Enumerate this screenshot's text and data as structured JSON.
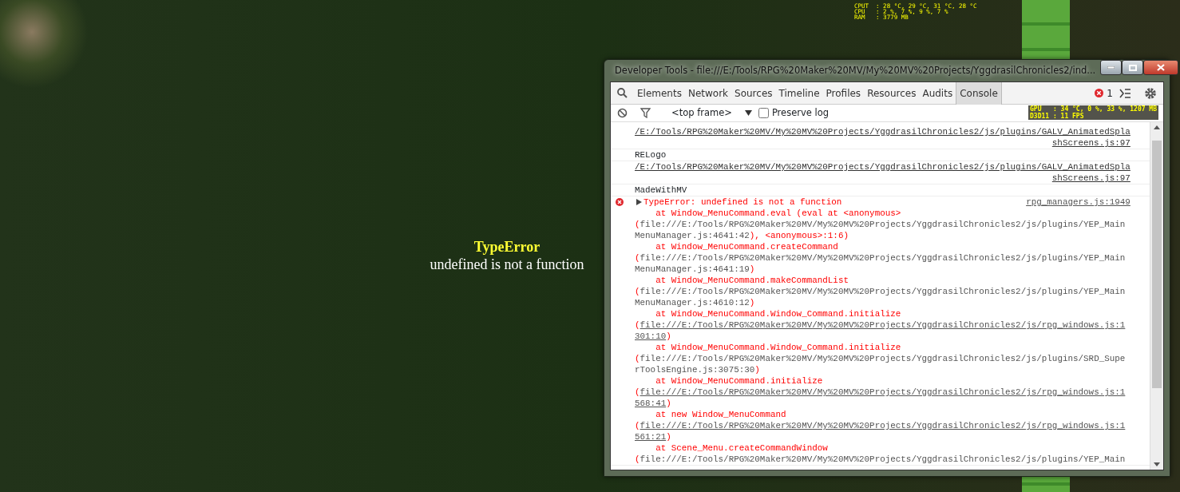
{
  "game": {
    "error_title": "TypeError",
    "error_message": "undefined is not a function",
    "stats": [
      "CPUT  : 28 °C, 29 °C, 31 °C, 28 °C",
      "CPU   : 2 %, 7 %, 9 %, 7 %",
      "RAM   : 3779 MB"
    ]
  },
  "window": {
    "title": "Developer Tools - file:///E:/Tools/RPG%20Maker%20MV/My%20MV%20Projects/YggdrasilChronicles2/ind..."
  },
  "tabs": [
    {
      "label": "Elements",
      "selected": false
    },
    {
      "label": "Network",
      "selected": false
    },
    {
      "label": "Sources",
      "selected": false
    },
    {
      "label": "Timeline",
      "selected": false
    },
    {
      "label": "Profiles",
      "selected": false
    },
    {
      "label": "Resources",
      "selected": false
    },
    {
      "label": "Audits",
      "selected": false
    },
    {
      "label": "Console",
      "selected": true
    }
  ],
  "error_count": "1",
  "filter_bar": {
    "context": "<top frame>",
    "preserve_log": {
      "label": "Preserve log",
      "checked": false
    }
  },
  "overlay_stats": [
    "GPU   : 34 °C, 0 %, 33 %, 1207 MB",
    "D3D11 : 11 FPS"
  ],
  "console": [
    {
      "kind": "source",
      "text": "/E:/Tools/RPG%20Maker%20MV/My%20MV%20Projects/YggdrasilChronicles2/js/plugins/GALV_AnimatedSplashScreens.js:97"
    },
    {
      "kind": "log",
      "text": "RELogo"
    },
    {
      "kind": "source",
      "text": "/E:/Tools/RPG%20Maker%20MV/My%20MV%20Projects/YggdrasilChronicles2/js/plugins/GALV_AnimatedSplashScreens.js:97"
    },
    {
      "kind": "log",
      "text": "MadeWithMV"
    },
    {
      "kind": "error",
      "message": "TypeError: undefined is not a function",
      "source": "rpg_managers.js:1949",
      "frames": [
        {
          "call": "at Window_MenuCommand.eval (eval at <anonymous>",
          "open": "(",
          "location": "file:///E:/Tools/RPG%20Maker%20MV/My%20MV%20Projects/YggdrasilChronicles2/js/plugins/YEP_MainMenuManager.js:4641:42",
          "close": "), <anonymous>:1:6)",
          "linked": false
        },
        {
          "call": "at Window_MenuCommand.createCommand",
          "open": "(",
          "location": "file:///E:/Tools/RPG%20Maker%20MV/My%20MV%20Projects/YggdrasilChronicles2/js/plugins/YEP_MainMenuManager.js:4641:19",
          "close": ")",
          "linked": false
        },
        {
          "call": "at Window_MenuCommand.makeCommandList",
          "open": "(",
          "location": "file:///E:/Tools/RPG%20Maker%20MV/My%20MV%20Projects/YggdrasilChronicles2/js/plugins/YEP_MainMenuManager.js:4610:12",
          "close": ")",
          "linked": false
        },
        {
          "call": "at Window_MenuCommand.Window_Command.initialize",
          "open": "(",
          "location": "file:///E:/Tools/RPG%20Maker%20MV/My%20MV%20Projects/YggdrasilChronicles2/js/rpg_windows.js:1301:10",
          "close": ")",
          "linked": true
        },
        {
          "call": "at Window_MenuCommand.Window_Command.initialize",
          "open": "(",
          "location": "file:///E:/Tools/RPG%20Maker%20MV/My%20MV%20Projects/YggdrasilChronicles2/js/plugins/SRD_SuperToolsEngine.js:3075:30",
          "close": ")",
          "linked": false
        },
        {
          "call": "at Window_MenuCommand.initialize",
          "open": "(",
          "location": "file:///E:/Tools/RPG%20Maker%20MV/My%20MV%20Projects/YggdrasilChronicles2/js/rpg_windows.js:1568:41",
          "close": ")",
          "linked": true
        },
        {
          "call": "at new Window_MenuCommand",
          "open": "(",
          "location": "file:///E:/Tools/RPG%20Maker%20MV/My%20MV%20Projects/YggdrasilChronicles2/js/rpg_windows.js:1561:21",
          "close": ")",
          "linked": true
        },
        {
          "call": "at Scene_Menu.createCommandWindow",
          "open": "(",
          "location": "file:///E:/Tools/RPG%20Maker%20MV/My%20MV%20Projects/YggdrasilChronicles2/js/plugins/YEP_Main",
          "linked": false
        }
      ]
    }
  ]
}
